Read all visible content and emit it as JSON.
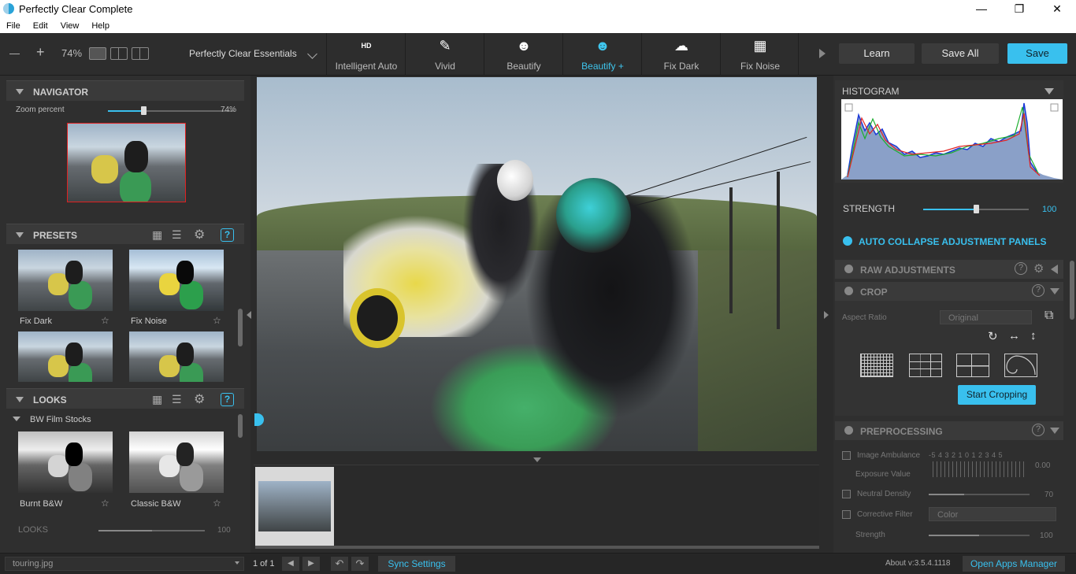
{
  "window": {
    "title": "Perfectly Clear Complete",
    "minimize": "—",
    "maximize": "❐",
    "close": "✕"
  },
  "menu": [
    "File",
    "Edit",
    "View",
    "Help"
  ],
  "toolbar": {
    "zoom_out": "—",
    "zoom_in": "+",
    "zoom_value": "74%",
    "preset_name": "Perfectly Clear Essentials",
    "tools": [
      {
        "label": "Intelligent Auto",
        "icon": "brush-hd-icon",
        "glyph": "HD"
      },
      {
        "label": "Vivid",
        "icon": "brush-icon",
        "glyph": "✎"
      },
      {
        "label": "Beautify",
        "icon": "face-icon",
        "glyph": "☻"
      },
      {
        "label": "Beautify +",
        "icon": "face-plus-icon",
        "glyph": "☻"
      },
      {
        "label": "Fix Dark",
        "icon": "cloud-icon",
        "glyph": "☁"
      },
      {
        "label": "Fix Noise",
        "icon": "noise-icon",
        "glyph": "▦"
      }
    ],
    "learn": "Learn",
    "save_all": "Save All",
    "save": "Save"
  },
  "navigator": {
    "title": "NAVIGATOR",
    "zoom_label": "Zoom percent",
    "zoom_value": "74%",
    "zoom_level": 0.74
  },
  "presets": {
    "title": "PRESETS",
    "items": [
      {
        "name": "Fix Dark"
      },
      {
        "name": "Fix Noise"
      },
      {
        "name": ""
      },
      {
        "name": ""
      }
    ]
  },
  "looks": {
    "title": "LOOKS",
    "category": "BW Film Stocks",
    "items": [
      {
        "name": "Burnt B&W"
      },
      {
        "name": "Classic B&W"
      }
    ],
    "strength_label": "LOOKS",
    "strength_value": "100",
    "strength_level": 1.0
  },
  "histogram": {
    "title": "HISTOGRAM"
  },
  "strength": {
    "label": "STRENGTH",
    "value": "100",
    "level": 0.5
  },
  "auto_collapse": "AUTO COLLAPSE ADJUSTMENT PANELS",
  "raw": {
    "title": "RAW ADJUSTMENTS"
  },
  "crop": {
    "title": "CROP",
    "aspect_label": "Aspect Ratio",
    "aspect_value": "Original",
    "start_button": "Start Cropping"
  },
  "preprocessing": {
    "title": "PREPROCESSING",
    "ambulance_label": "Image Ambulance",
    "ambulance_scale": "-5 4 3 2 1 0 1 2 3 4 5",
    "exposure_label": "Exposure Value",
    "exposure_value": "0.00",
    "neutral_label": "Neutral Density",
    "neutral_value": "70",
    "neutral_level": 0.35,
    "filter_label": "Corrective Filter",
    "filter_value": "Color",
    "strength_label": "Strength",
    "strength_value": "100",
    "strength_level": 0.5
  },
  "status": {
    "file": "touring.jpg",
    "page": "1 of 1",
    "sync": "Sync Settings",
    "version": "About v:3.5.4.1118",
    "apps": "Open Apps Manager"
  },
  "colors": {
    "accent": "#39c0ee",
    "bg": "#2b2b2b",
    "panel": "#2f2f2f"
  }
}
